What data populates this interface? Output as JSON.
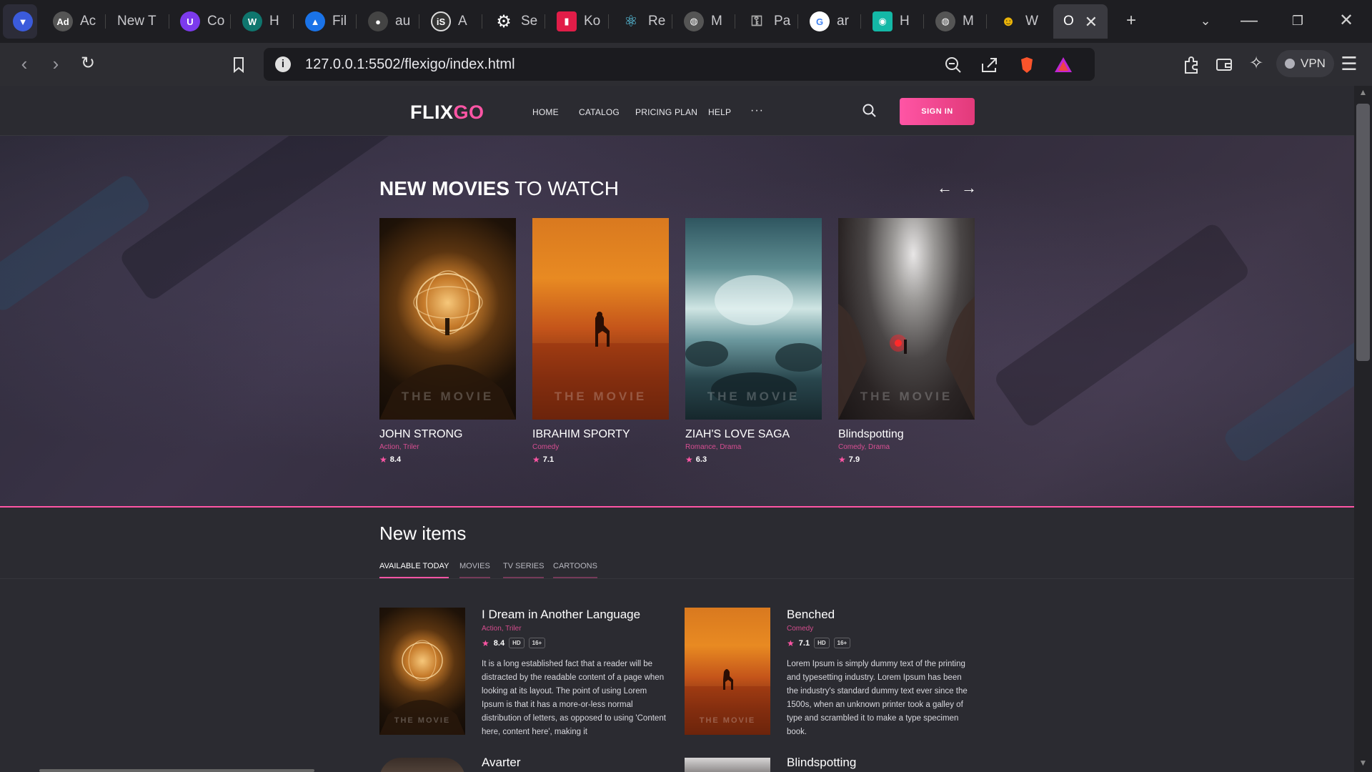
{
  "browser": {
    "tabs": [
      {
        "label": "",
        "icon": "brave-icon",
        "color": "#3b5bdb"
      },
      {
        "label": "Ac",
        "icon": "ad-icon",
        "color": "#555"
      },
      {
        "label": "New T",
        "icon": "",
        "color": ""
      },
      {
        "label": "Co",
        "icon": "u-icon",
        "color": "#7c3aed"
      },
      {
        "label": "H",
        "icon": "w-icon",
        "color": "#0f766e"
      },
      {
        "label": "Fil",
        "icon": "drive-icon",
        "color": "#1a73e8"
      },
      {
        "label": "au",
        "icon": "github-icon",
        "color": "#444"
      },
      {
        "label": "A",
        "icon": "is-icon",
        "color": "#333"
      },
      {
        "label": "Se",
        "icon": "gear-icon",
        "color": "#333"
      },
      {
        "label": "Ko",
        "icon": "chef-icon",
        "color": "#e11d48"
      },
      {
        "label": "Re",
        "icon": "react-icon",
        "color": "#0e7490"
      },
      {
        "label": "M",
        "icon": "globe-icon",
        "color": "#555"
      },
      {
        "label": "Pa",
        "icon": "key-icon",
        "color": "#555"
      },
      {
        "label": "ar",
        "icon": "google-icon",
        "color": "#ffffff"
      },
      {
        "label": "H",
        "icon": "code-icon",
        "color": "#14b8a6"
      },
      {
        "label": "M",
        "icon": "globe-icon",
        "color": "#555"
      },
      {
        "label": "W",
        "icon": "owl-icon",
        "color": "#a16207"
      },
      {
        "label": "O",
        "icon": "",
        "color": ""
      }
    ],
    "url": "127.0.0.1:5502/flexigo/index.html",
    "vpn_label": "VPN"
  },
  "site": {
    "logo_part1": "FLIX",
    "logo_part2": "GO",
    "nav": [
      "HOME",
      "CATALOG",
      "PRICING PLAN",
      "HELP"
    ],
    "nav_more": "···",
    "signin_label": "SIGN IN",
    "accent": "#ff55a5"
  },
  "hero": {
    "title_bold": "NEW MOVIES",
    "title_rest": " TO WATCH",
    "prev_arrow": "←",
    "next_arrow": "→",
    "cards": [
      {
        "title": "JOHN STRONG",
        "genre": "Action, Triler",
        "rating": "8.4",
        "watermark": "THE MOVIE"
      },
      {
        "title": "IBRAHIM SPORTY",
        "genre": "Comedy",
        "rating": "7.1",
        "watermark": "THE MOVIE"
      },
      {
        "title": "ZIAH'S LOVE SAGA",
        "genre": "Romance, Drama",
        "rating": "6.3",
        "watermark": "THE MOVIE"
      },
      {
        "title": "Blindspotting",
        "genre": "Comedy, Drama",
        "rating": "7.9",
        "watermark": "THE MOVIE"
      }
    ]
  },
  "new_items": {
    "title": "New items",
    "tabs": [
      "AVAILABLE TODAY",
      "MOVIES",
      "TV SERIES",
      "CARTOONS"
    ],
    "items": [
      {
        "title": "I Dream in Another Language",
        "genre": "Action, Triler",
        "rating": "8.4",
        "badge1": "HD",
        "badge2": "16+",
        "watermark": "THE MOVIE",
        "desc": "It is a long established fact that a reader will be distracted by the readable content of a page when looking at its layout. The point of using Lorem Ipsum is that it has a more-or-less normal distribution of letters, as opposed to using 'Content here, content here', making it"
      },
      {
        "title": "Benched",
        "genre": "Comedy",
        "rating": "7.1",
        "badge1": "HD",
        "badge2": "16+",
        "watermark": "THE MOVIE",
        "desc": "Lorem Ipsum is simply dummy text of the printing and typesetting industry. Lorem Ipsum has been the industry's standard dummy text ever since the 1500s, when an unknown printer took a galley of type and scrambled it to make a type specimen book."
      },
      {
        "title": "Avarter"
      },
      {
        "title": "Blindspotting"
      }
    ]
  }
}
